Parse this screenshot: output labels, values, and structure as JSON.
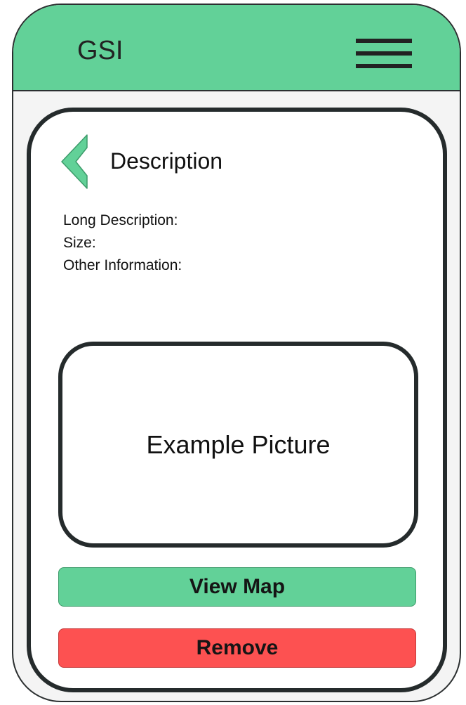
{
  "header": {
    "app_title": "GSI",
    "menu_icon": "hamburger-menu-icon"
  },
  "detail": {
    "back_icon": "chevron-left-icon",
    "title": "Description",
    "fields": [
      "Long Description:",
      "Size:",
      "Other Information:"
    ],
    "picture_label": "Example Picture"
  },
  "actions": {
    "view_map_label": "View Map",
    "remove_label": "Remove"
  },
  "colors": {
    "accent": "#62d198",
    "danger": "#fd5151",
    "outline": "#252b2c"
  }
}
